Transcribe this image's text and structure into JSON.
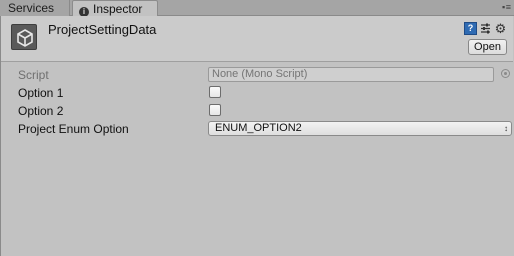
{
  "tabs": [
    {
      "label": "Services"
    },
    {
      "label": "Inspector"
    }
  ],
  "header": {
    "title": "ProjectSettingData",
    "open_label": "Open",
    "help_glyph": "?",
    "icons": [
      "unity-cube-icon",
      "help-icon",
      "preset-icon",
      "gear-icon"
    ]
  },
  "fields": {
    "script": {
      "label": "Script",
      "value": "None (Mono Script)"
    },
    "option1": {
      "label": "Option 1",
      "checked": false
    },
    "option2": {
      "label": "Option 2",
      "checked": false
    },
    "enum": {
      "label": "Project Enum Option",
      "value": "ENUM_OPTION2"
    }
  },
  "colors": {
    "panel_bg": "#c2c2c2",
    "tabbar_bg": "#a5a5a5",
    "help_blue": "#2f6bb3"
  }
}
